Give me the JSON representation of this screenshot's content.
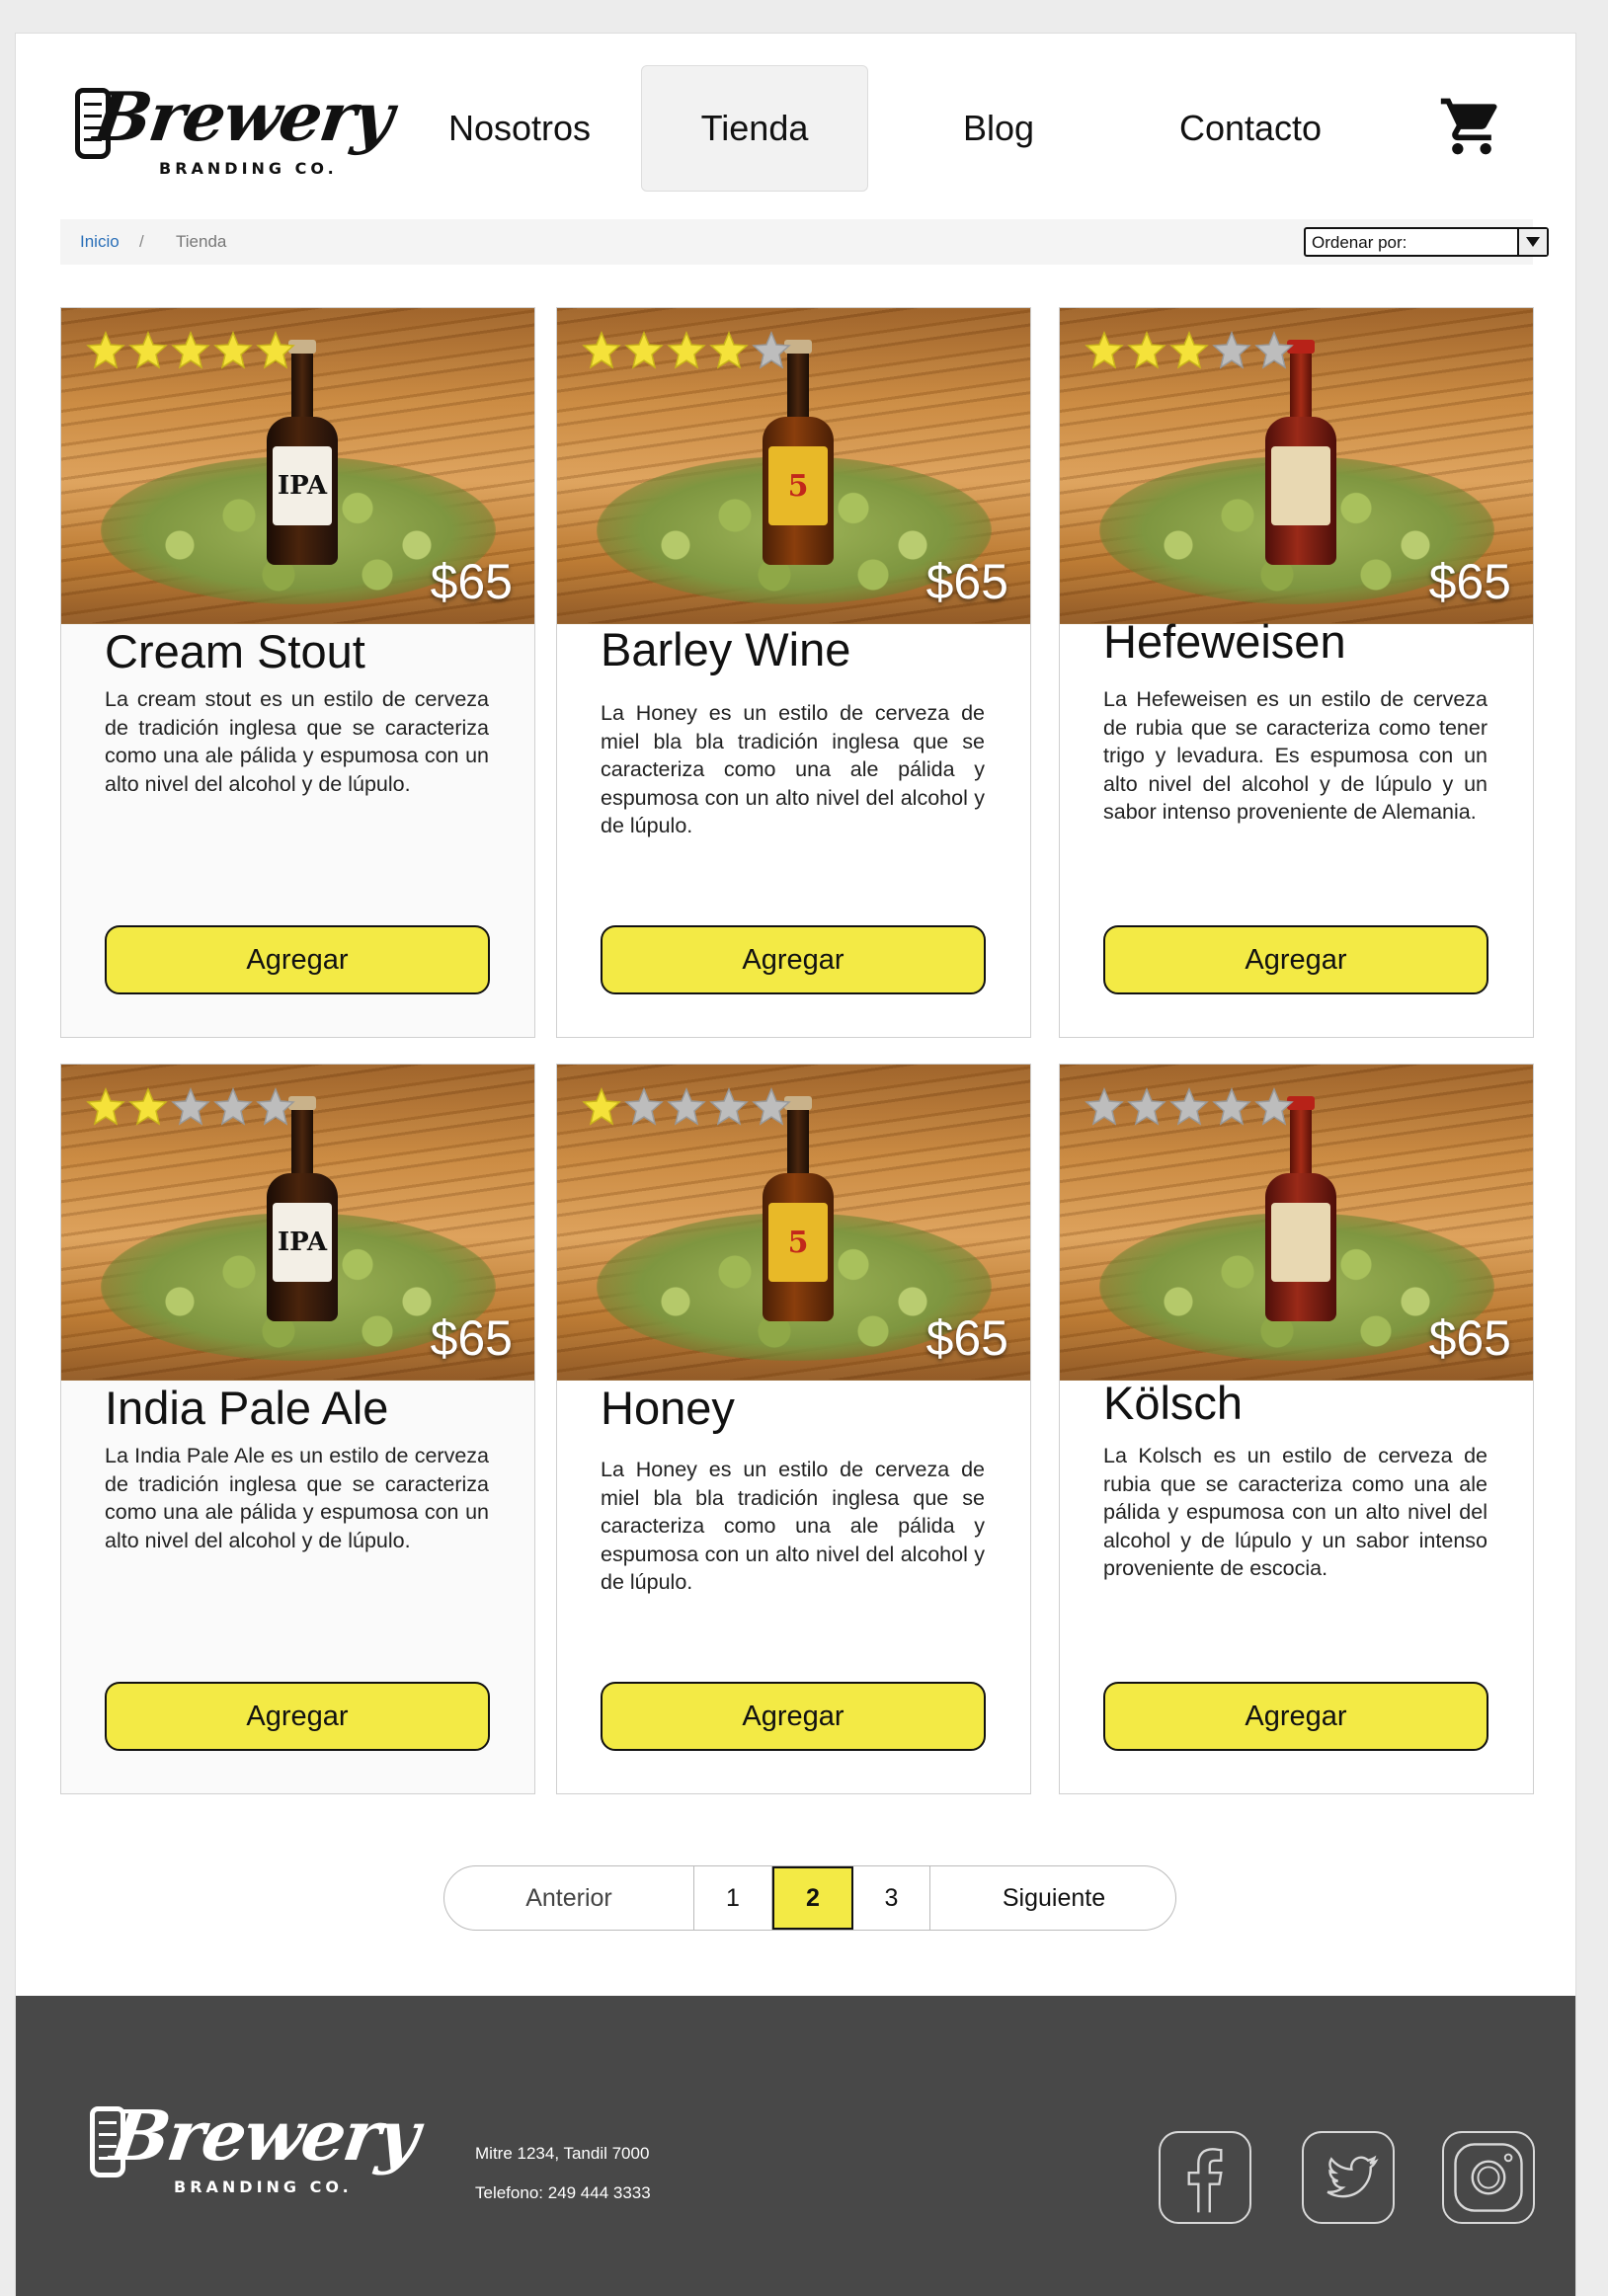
{
  "brand": {
    "name": "Brewery",
    "tagline": "BRANDING CO."
  },
  "nav": {
    "items": [
      {
        "label": "Nosotros"
      },
      {
        "label": "Tienda"
      },
      {
        "label": "Blog"
      },
      {
        "label": "Contacto"
      }
    ],
    "active": "Tienda",
    "cart_icon": "shopping-cart-icon"
  },
  "breadcrumb": {
    "home": "Inicio",
    "separator": "/",
    "current": "Tienda"
  },
  "sort": {
    "label": "Ordenar por:"
  },
  "products": [
    {
      "title": "Cream Stout",
      "price": "$65",
      "rating": 5,
      "description": "La cream stout es un estilo de cerveza de tradición inglesa que se caracteriza como una ale pálida y espumosa con un alto nivel del alcohol y de lúpulo.",
      "button": "Agregar",
      "bottle_label": "IPA"
    },
    {
      "title": "Barley Wine",
      "price": "$65",
      "rating": 4,
      "description": "La Honey es un estilo de cerveza de miel bla bla tradición inglesa que se caracteriza como una ale pálida y espumosa con un alto nivel del alcohol y de lúpulo.",
      "button": "Agregar",
      "bottle_label": "5"
    },
    {
      "title": "Hefeweisen",
      "price": "$65",
      "rating": 3,
      "description": "La Hefeweisen es un estilo de cerveza de rubia que se caracteriza como tener trigo y levadura. Es espumosa con un alto nivel del alcohol y de lúpulo y un sabor intenso proveniente de Alemania.",
      "button": "Agregar",
      "bottle_label": ""
    },
    {
      "title": "India Pale Ale",
      "price": "$65",
      "rating": 2,
      "description": "La India Pale Ale es un estilo de cerveza de tradición inglesa que se caracteriza como una ale pálida y espumosa con un alto nivel del alcohol y de lúpulo.",
      "button": "Agregar",
      "bottle_label": "IPA"
    },
    {
      "title": "Honey",
      "price": "$65",
      "rating": 1,
      "description": "La Honey es un estilo de cerveza de miel bla bla tradición inglesa que se caracteriza como una ale pálida y espumosa con un alto nivel del alcohol y de lúpulo.",
      "button": "Agregar",
      "bottle_label": "5"
    },
    {
      "title": "Kölsch",
      "price": "$65",
      "rating": 0,
      "description": "La Kolsch  es un estilo de cerveza de rubia que se caracteriza como una ale pálida y espumosa con un alto nivel del alcohol y de lúpulo y un sabor intenso proveniente de escocia.",
      "button": "Agregar",
      "bottle_label": ""
    }
  ],
  "pagination": {
    "prev": "Anterior",
    "pages": [
      "1",
      "2",
      "3"
    ],
    "current": "2",
    "next": "Siguiente"
  },
  "footer": {
    "address": "Mitre 1234, Tandil 7000",
    "phone": "Telefono: 249 444 3333",
    "social": [
      "facebook-icon",
      "twitter-icon",
      "instagram-icon"
    ]
  },
  "colors": {
    "accent": "#f3ea45",
    "footer_bg": "#484848",
    "star_on": "#f5e23a",
    "star_off": "#bdbdbd",
    "link": "#2a6fb8"
  }
}
